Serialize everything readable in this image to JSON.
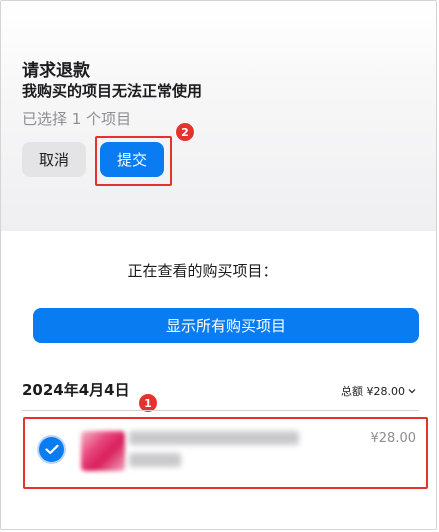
{
  "dialog": {
    "title": "请求退款",
    "reason": "我购买的项目无法正常使用",
    "selected_note": "已选择 1 个项目",
    "cancel_label": "取消",
    "submit_label": "提交"
  },
  "purchases": {
    "viewing_label": "正在查看的购买项目：",
    "show_all_label": "显示所有购买项目",
    "date": "2024年4月4日",
    "total": "总额 ¥28.00",
    "items": [
      {
        "price": "¥28.00",
        "selected": true
      }
    ]
  },
  "annotations": {
    "badge_1": "1",
    "badge_2": "2"
  },
  "colors": {
    "accent": "#0a7cf2",
    "annotation_red": "#e5322d",
    "cancel_bg": "#e4e4e7"
  }
}
